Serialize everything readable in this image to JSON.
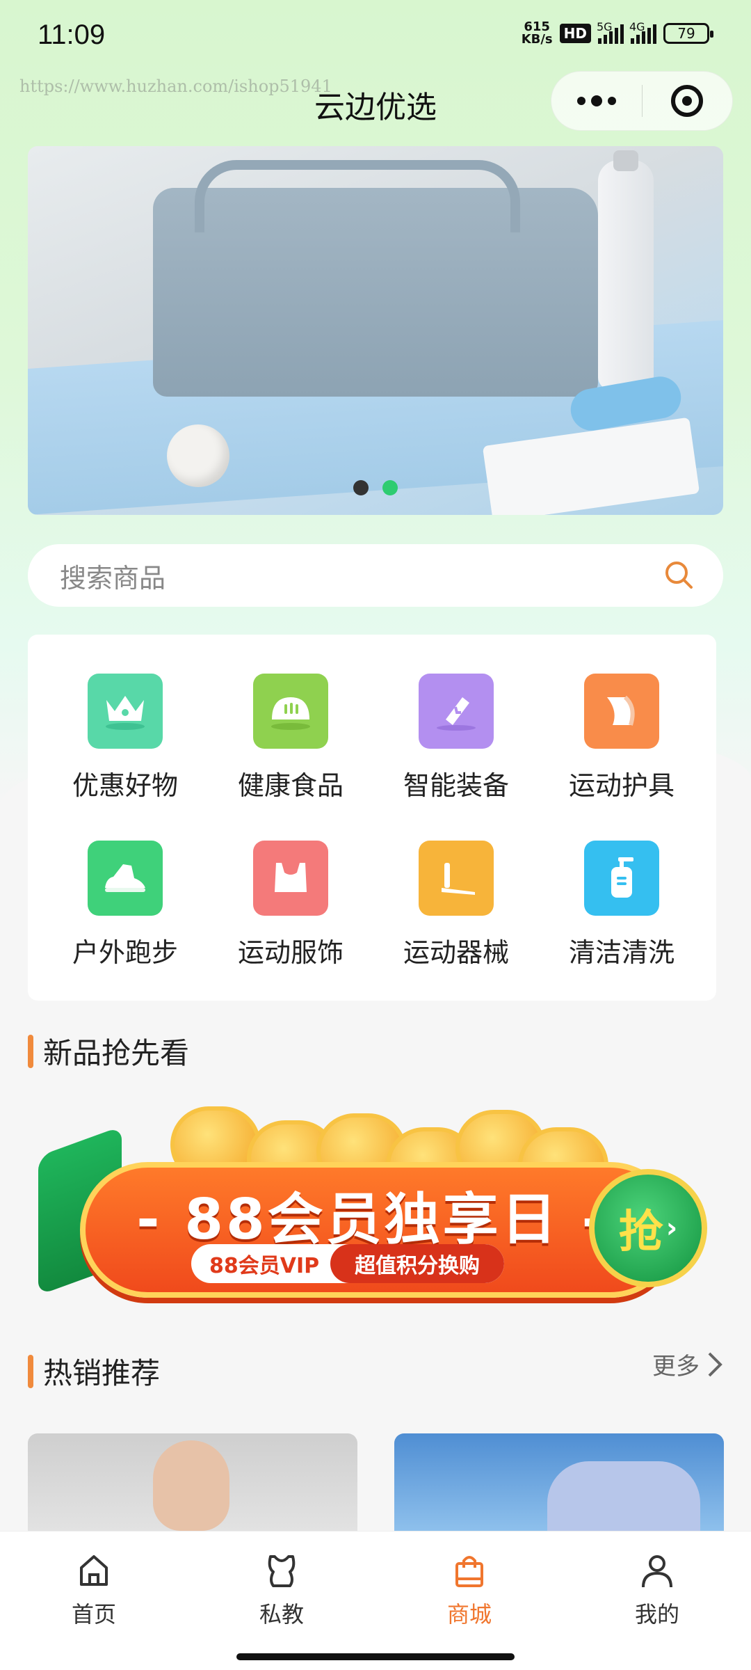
{
  "status_bar": {
    "time": "11:09",
    "net_speed_value": "615",
    "net_speed_unit": "KB/s",
    "hd_badge": "HD",
    "sig1_label": "5G",
    "sig2_label": "4G",
    "battery": "79"
  },
  "nav": {
    "title": "云边优选",
    "watermark": "https://www.huzhan.com/ishop51941"
  },
  "banner": {
    "slides": 2,
    "active_slide": 2
  },
  "search": {
    "placeholder": "搜索商品"
  },
  "categories": [
    {
      "label": "优惠好物",
      "icon": "crown-icon",
      "color": "#58d8a8"
    },
    {
      "label": "健康食品",
      "icon": "bread-icon",
      "color": "#8fd14f"
    },
    {
      "label": "智能装备",
      "icon": "sync-device-icon",
      "color": "#b38ff0"
    },
    {
      "label": "运动护具",
      "icon": "knee-pad-icon",
      "color": "#f98c4a"
    },
    {
      "label": "户外跑步",
      "icon": "running-shoe-icon",
      "color": "#3fd17a"
    },
    {
      "label": "运动服饰",
      "icon": "sports-bra-icon",
      "color": "#f47a7a"
    },
    {
      "label": "运动器械",
      "icon": "treadmill-icon",
      "color": "#f7b43a"
    },
    {
      "label": "清洁清洗",
      "icon": "soap-dispenser-icon",
      "color": "#35bff0"
    }
  ],
  "sections": {
    "new_products": "新品抢先看",
    "hot_sales": "热销推荐",
    "more": "更多"
  },
  "promo": {
    "headline": "- 88会员独享日 -",
    "tag_left": "88会员VIP",
    "tag_right": "超值积分换购",
    "button": "抢"
  },
  "tabbar": {
    "items": [
      {
        "label": "首页",
        "icon": "home-icon"
      },
      {
        "label": "私教",
        "icon": "coach-icon"
      },
      {
        "label": "商城",
        "icon": "shopping-bag-icon"
      },
      {
        "label": "我的",
        "icon": "user-icon"
      }
    ],
    "active": "商城",
    "accent": "#f0762e"
  }
}
